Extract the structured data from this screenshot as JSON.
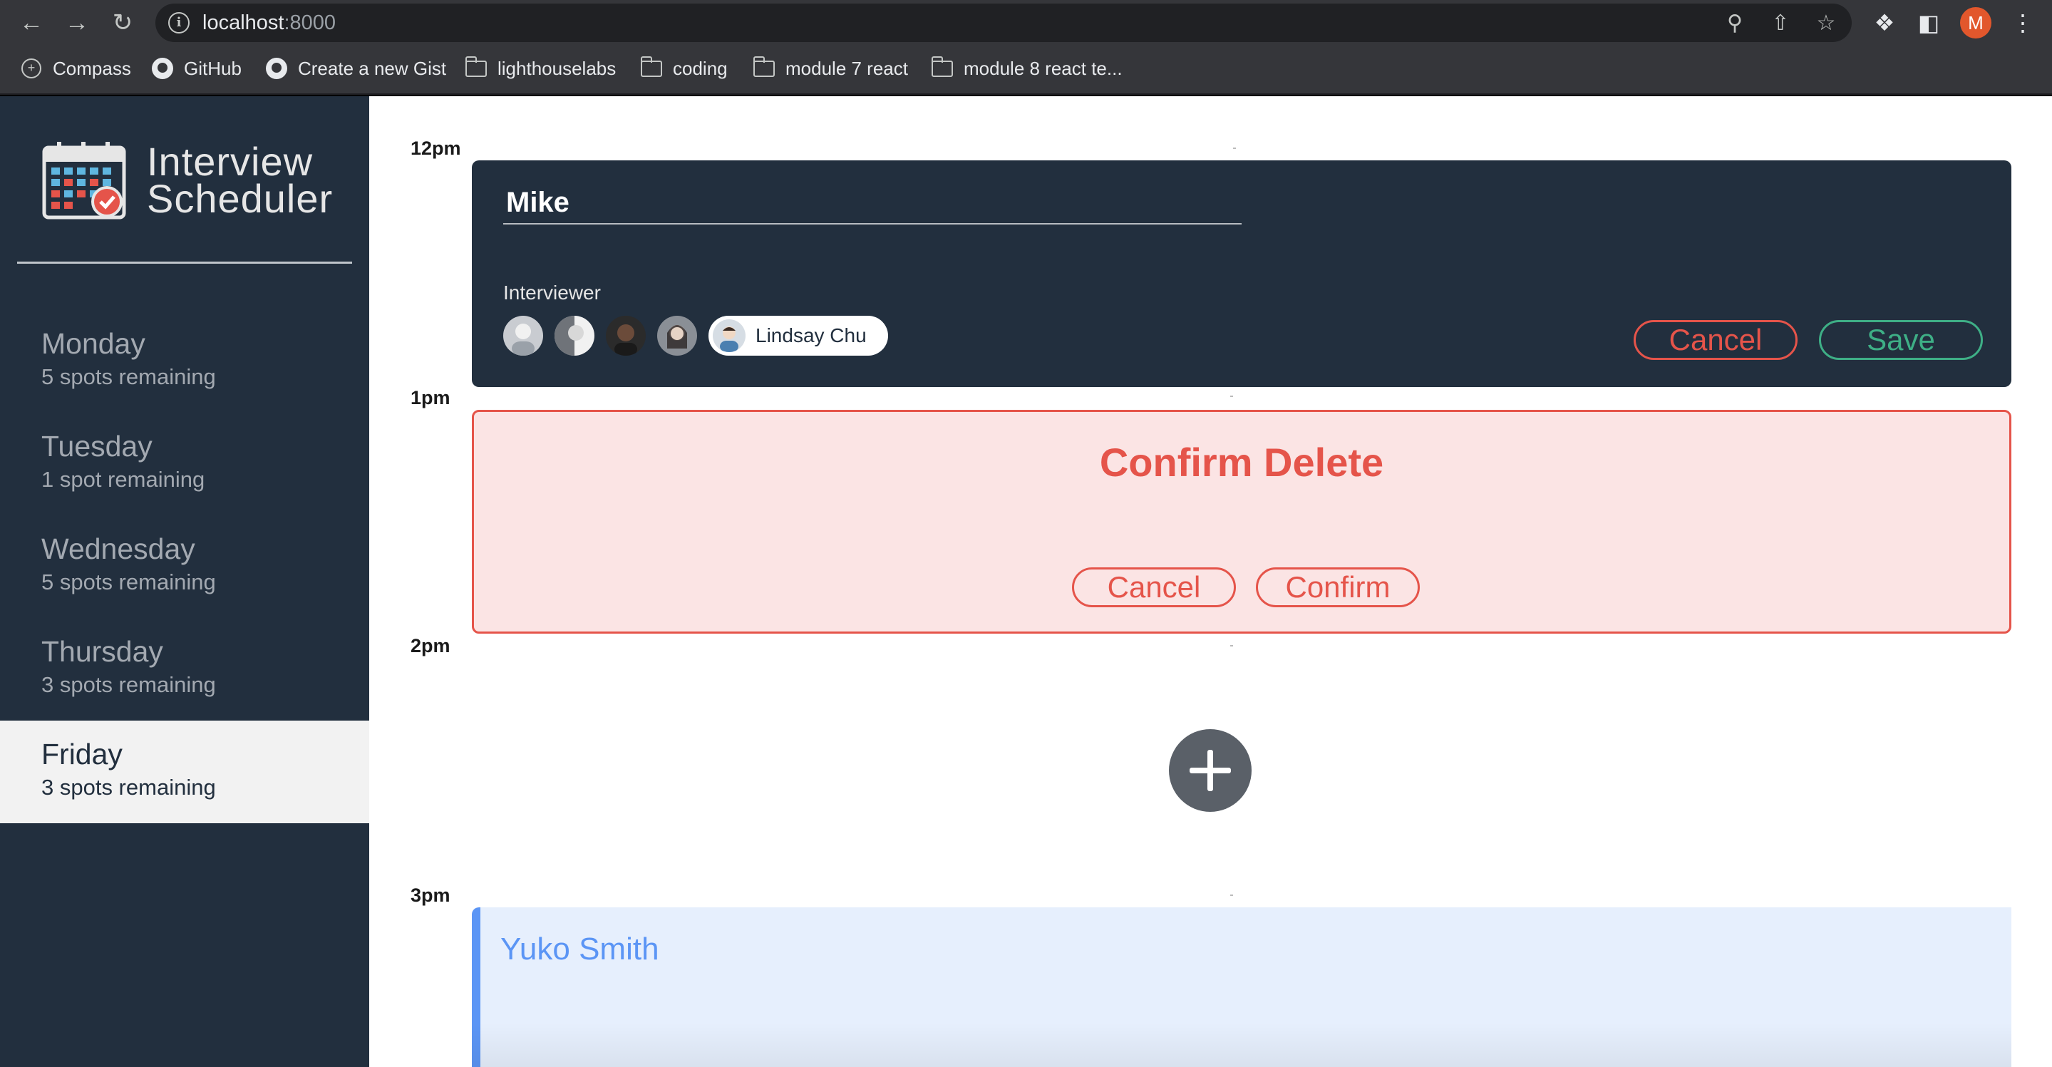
{
  "browser": {
    "url_host": "localhost",
    "url_port": ":8000",
    "profile_initial": "M",
    "bookmarks": [
      {
        "label": "Compass",
        "icon": "compass-icon"
      },
      {
        "label": "GitHub",
        "icon": "github-icon"
      },
      {
        "label": "Create a new Gist",
        "icon": "github-icon"
      },
      {
        "label": "lighthouselabs",
        "icon": "folder-icon"
      },
      {
        "label": "coding",
        "icon": "folder-icon"
      },
      {
        "label": "module 7 react",
        "icon": "folder-icon"
      },
      {
        "label": "module 8 react te...",
        "icon": "folder-icon"
      }
    ]
  },
  "sidebar": {
    "brand_line1": "Interview",
    "brand_line2": "Scheduler",
    "days": [
      {
        "name": "Monday",
        "spots": "5 spots remaining",
        "selected": false
      },
      {
        "name": "Tuesday",
        "spots": "1 spot remaining",
        "selected": false
      },
      {
        "name": "Wednesday",
        "spots": "5 spots remaining",
        "selected": false
      },
      {
        "name": "Thursday",
        "spots": "3 spots remaining",
        "selected": false
      },
      {
        "name": "Friday",
        "spots": "3 spots remaining",
        "selected": true
      }
    ]
  },
  "schedule": {
    "times": [
      "12pm",
      "1pm",
      "2pm",
      "3pm"
    ],
    "form": {
      "student_value": "Mike",
      "interviewer_label": "Interviewer",
      "selected_interviewer": "Lindsay Chu",
      "cancel_label": "Cancel",
      "save_label": "Save"
    },
    "confirm": {
      "title": "Confirm Delete",
      "cancel_label": "Cancel",
      "confirm_label": "Confirm"
    },
    "show": {
      "student": "Yuko Smith"
    }
  },
  "colors": {
    "sidebar_bg": "#222f3e",
    "danger": "#e5544a",
    "success": "#3eaf86",
    "show_accent": "#5b95f5"
  }
}
